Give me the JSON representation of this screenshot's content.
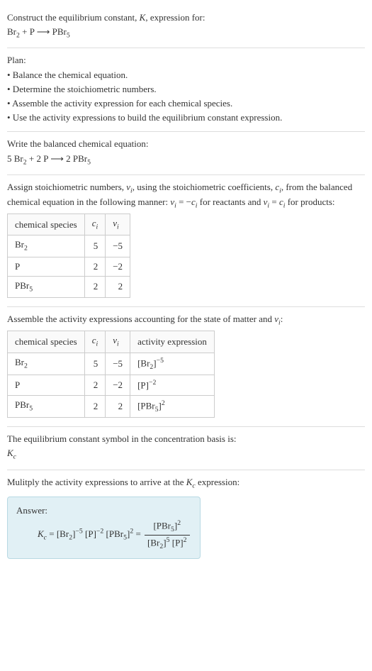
{
  "intro": {
    "line1": "Construct the equilibrium constant, ",
    "ksym": "K",
    "line1b": ", expression for:",
    "eq_left": "Br",
    "eq_left_sub": "2",
    "eq_plus": " + P ",
    "eq_arrow": "⟶",
    "eq_right": " PBr",
    "eq_right_sub": "5"
  },
  "plan": {
    "title": "Plan:",
    "b1": "• Balance the chemical equation.",
    "b2": "• Determine the stoichiometric numbers.",
    "b3": "• Assemble the activity expression for each chemical species.",
    "b4": "• Use the activity expressions to build the equilibrium constant expression."
  },
  "balanced": {
    "title": "Write the balanced chemical equation:",
    "c1": "5 Br",
    "s1": "2",
    "c2": " + 2 P ",
    "arrow": "⟶",
    "c3": " 2 PBr",
    "s3": "5"
  },
  "stoich": {
    "title1": "Assign stoichiometric numbers, ",
    "nu": "ν",
    "isub": "i",
    "title2": ", using the stoichiometric coefficients, ",
    "csym": "c",
    "title3": ", from the balanced chemical equation in the following manner: ",
    "rel1a": "ν",
    "rel1b": " = −",
    "rel1c": "c",
    "rel1d": " for reactants and ",
    "rel2a": "ν",
    "rel2b": " = ",
    "rel2c": "c",
    "rel2d": " for products:",
    "h1": "chemical species",
    "h2": "c",
    "h3": "ν",
    "rows": [
      {
        "sp": "Br",
        "spsub": "2",
        "c": "5",
        "v": "−5"
      },
      {
        "sp": "P",
        "spsub": "",
        "c": "2",
        "v": "−2"
      },
      {
        "sp": "PBr",
        "spsub": "5",
        "c": "2",
        "v": "2"
      }
    ]
  },
  "activity": {
    "title": "Assemble the activity expressions accounting for the state of matter and ",
    "nu": "ν",
    "isub": "i",
    "colon": ":",
    "h1": "chemical species",
    "h2": "c",
    "h3": "ν",
    "h4": "activity expression",
    "rows": [
      {
        "sp": "Br",
        "spsub": "2",
        "c": "5",
        "v": "−5",
        "ae_base": "[Br",
        "ae_bsub": "2",
        "ae_exp": "−5"
      },
      {
        "sp": "P",
        "spsub": "",
        "c": "2",
        "v": "−2",
        "ae_base": "[P]",
        "ae_bsub": "",
        "ae_exp": "−2"
      },
      {
        "sp": "PBr",
        "spsub": "5",
        "c": "2",
        "v": "2",
        "ae_base": "[PBr",
        "ae_bsub": "5",
        "ae_exp": "2"
      }
    ]
  },
  "kb": {
    "title": "The equilibrium constant symbol in the concentration basis is:",
    "sym": "K",
    "sub": "c"
  },
  "mult": {
    "title1": "Mulitply the activity expressions to arrive at the ",
    "ksym": "K",
    "ksub": "c",
    "title2": " expression:"
  },
  "answer": {
    "label": "Answer:",
    "lhs_k": "K",
    "lhs_ks": "c",
    "eq": " = ",
    "t1": "[Br",
    "t1s": "2",
    "t1e": "−5",
    "t2": " [P]",
    "t2e": "−2",
    "t3": " [PBr",
    "t3s": "5",
    "t3e": "2",
    "eq2": " = ",
    "num": "[PBr",
    "nums": "5",
    "nume": "2",
    "den1": "[Br",
    "den1s": "2",
    "den1e": "5",
    "den2": " [P]",
    "den2e": "2"
  }
}
